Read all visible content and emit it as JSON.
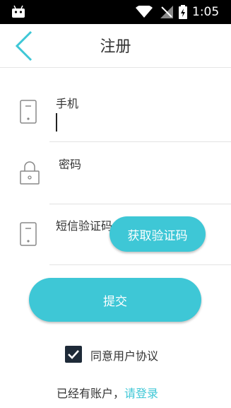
{
  "status_bar": {
    "time": "1:05",
    "icons": [
      "android-icon",
      "wifi-icon",
      "no-signal-icon",
      "battery-charging-icon"
    ]
  },
  "app_bar": {
    "title": "注册",
    "back_icon": "chevron-left-icon"
  },
  "form": {
    "phone": {
      "label": "手机",
      "icon": "phone-icon",
      "value": ""
    },
    "password": {
      "label": "密码",
      "icon": "lock-icon",
      "value": ""
    },
    "sms_code": {
      "label": "短信验证码",
      "icon": "phone-icon",
      "value": ""
    },
    "get_code_label": "获取验证码"
  },
  "submit_label": "提交",
  "agreement": {
    "label": "同意用户协议",
    "checked": true
  },
  "login": {
    "prefix": "已经有账户，",
    "link": "请登录"
  },
  "colors": {
    "accent": "#3ec7d6",
    "checkbox": "#1e2a38"
  }
}
